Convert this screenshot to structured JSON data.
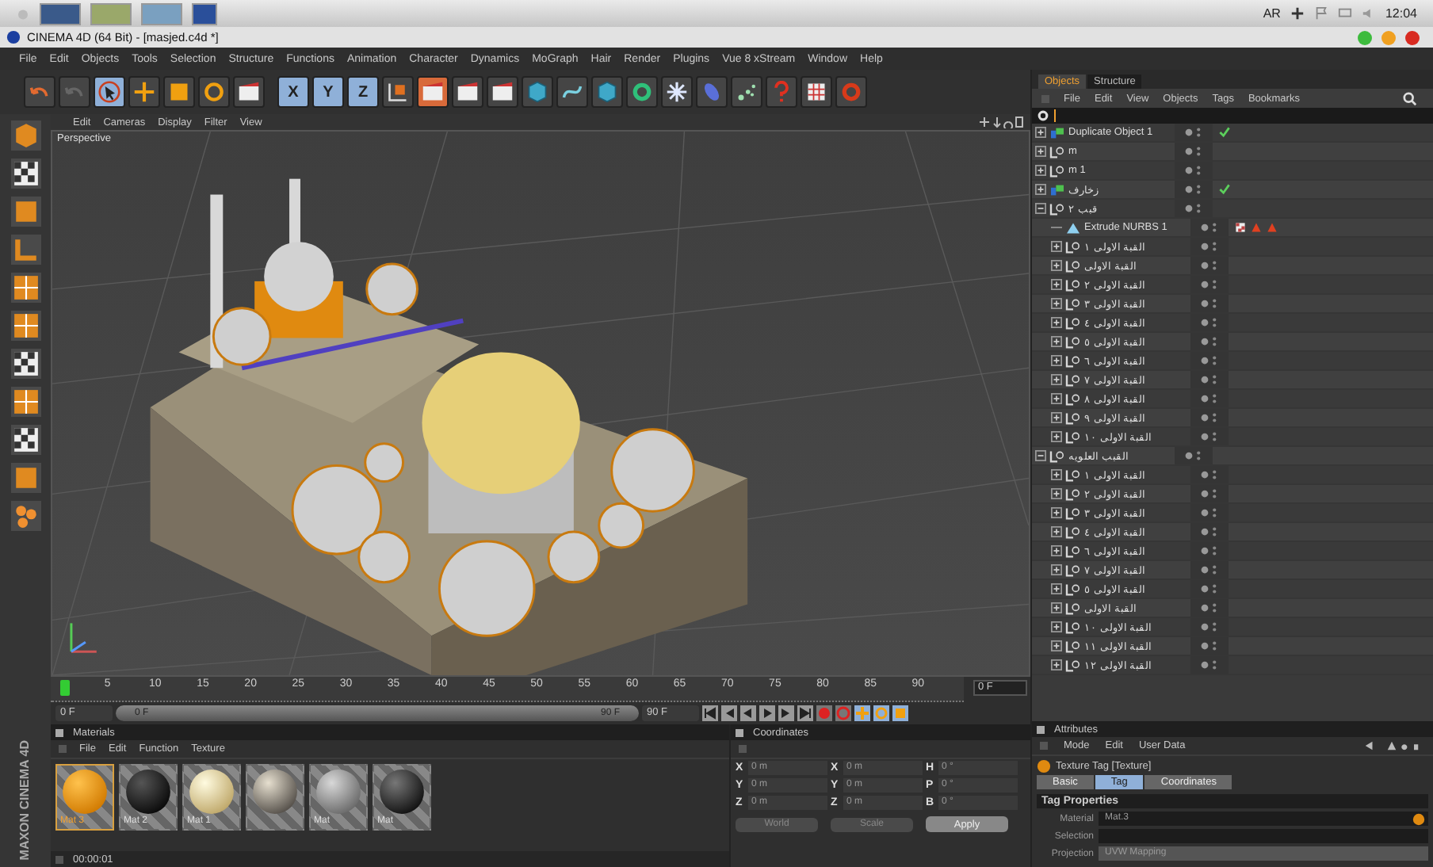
{
  "os_bar": {
    "language": "AR",
    "clock": "12:04"
  },
  "window": {
    "title": "CINEMA 4D (64 Bit) - [masjed.c4d *]"
  },
  "menu": [
    "File",
    "Edit",
    "Objects",
    "Tools",
    "Selection",
    "Structure",
    "Functions",
    "Animation",
    "Character",
    "Dynamics",
    "MoGraph",
    "Hair",
    "Render",
    "Plugins",
    "Vue 8 xStream",
    "Window",
    "Help"
  ],
  "toolbar": {
    "axis_buttons": [
      {
        "label": "X",
        "selected": true
      },
      {
        "label": "Y",
        "selected": true
      },
      {
        "label": "Z",
        "selected": true
      }
    ]
  },
  "viewport": {
    "menu": [
      "Edit",
      "Cameras",
      "Display",
      "Filter",
      "View"
    ],
    "camera": "Perspective"
  },
  "timeline": {
    "ticks": [
      "5",
      "10",
      "15",
      "20",
      "25",
      "30",
      "35",
      "40",
      "45",
      "50",
      "55",
      "60",
      "65",
      "70",
      "75",
      "80",
      "85",
      "90"
    ],
    "playhead": {
      "level": 0
    },
    "current_frame": "0 F",
    "start_field": "0 F",
    "range": {
      "level": 1
    },
    "range_start": "0 F",
    "range_end": "90 F",
    "end_field": "90 F"
  },
  "materials": {
    "title": "Materials",
    "menu": [
      "File",
      "Edit",
      "Function",
      "Texture"
    ],
    "items": [
      {
        "label": "Mat 3",
        "kind": "orange",
        "selected": true
      },
      {
        "label": "Mat 2",
        "kind": "black",
        "selected": false
      },
      {
        "label": "Mat 1",
        "kind": "cream",
        "selected": false
      },
      {
        "kind": "rough",
        "selected": false
      },
      {
        "label": "Mat",
        "kind": "glass",
        "selected": false
      },
      {
        "label": "Mat",
        "kind": "dark",
        "selected": false
      }
    ],
    "status": "00:00:01",
    "logo": "MAXON CINEMA 4D"
  },
  "coordinates": {
    "title": "Coordinates",
    "rows": [
      {
        "position_label": "X",
        "position_value": "0 m",
        "size_label": "X",
        "size_value": "0 m",
        "rotation_label": "H",
        "rotation_value": "0 °"
      },
      {
        "position_label": "Y",
        "position_value": "0 m",
        "size_label": "Y",
        "size_value": "0 m",
        "rotation_label": "P",
        "rotation_value": "0 °"
      },
      {
        "position_label": "Z",
        "position_value": "0 m",
        "size_label": "Z",
        "size_value": "0 m",
        "rotation_label": "B",
        "rotation_value": "0 °"
      }
    ],
    "mode_dropdown": "World",
    "size_dropdown": "Scale",
    "apply": "Apply"
  },
  "objects": {
    "tabs": [
      {
        "label": "Objects",
        "selected": true
      },
      {
        "label": "Structure",
        "selected": false
      }
    ],
    "menu": [
      "File",
      "Edit",
      "View",
      "Objects",
      "Tags",
      "Bookmarks"
    ],
    "tree": [
      {
        "name": "Duplicate Object 1",
        "kind": "duplicate",
        "expanded": false,
        "tags": [
          {
            "kind": "check"
          }
        ]
      },
      {
        "name": "m",
        "kind": "null",
        "expanded": false
      },
      {
        "name": "m 1",
        "kind": "null",
        "expanded": false
      },
      {
        "name": "زخارف",
        "kind": "duplicate",
        "expanded": false,
        "tags": [
          {
            "kind": "check"
          }
        ]
      },
      {
        "name": "قبب ٢",
        "kind": "null",
        "expanded": true,
        "children": [
          {
            "name": "Extrude NURBS 1",
            "kind": "extrude",
            "tags": [
              {
                "kind": "texture"
              },
              {
                "kind": "warning"
              },
              {
                "kind": "warning"
              }
            ]
          },
          {
            "name": "القبة الاولى ١",
            "kind": "null",
            "expanded": false
          },
          {
            "name": "القبة الاولى",
            "kind": "null",
            "expanded": false
          },
          {
            "name": "القبة الاولى ٢",
            "kind": "null",
            "expanded": false
          },
          {
            "name": "القبة الاولى ٣",
            "kind": "null",
            "expanded": false
          },
          {
            "name": "القبة الاولى ٤",
            "kind": "null",
            "expanded": false
          },
          {
            "name": "القبة الاولى ٥",
            "kind": "null",
            "expanded": false
          },
          {
            "name": "القبة الاولى ٦",
            "kind": "null",
            "expanded": false
          },
          {
            "name": "القبة الاولى ٧",
            "kind": "null",
            "expanded": false
          },
          {
            "name": "القبة الاولى ٨",
            "kind": "null",
            "expanded": false
          },
          {
            "name": "القبة الاولى ٩",
            "kind": "null",
            "expanded": false
          },
          {
            "name": "القبة الاولى ١٠",
            "kind": "null",
            "expanded": false
          }
        ]
      },
      {
        "name": "القبب العلويه",
        "kind": "null",
        "expanded": true,
        "children": [
          {
            "name": "القبة الاولى ١",
            "kind": "null",
            "expanded": false
          },
          {
            "name": "القبة الاولى ٢",
            "kind": "null",
            "expanded": false
          },
          {
            "name": "القبة الاولى ٣",
            "kind": "null",
            "expanded": false
          },
          {
            "name": "القبة الاولى ٤",
            "kind": "null",
            "expanded": false
          },
          {
            "name": "القبة الاولى ٦",
            "kind": "null",
            "expanded": false
          },
          {
            "name": "القبة الاولى ٧",
            "kind": "null",
            "expanded": false
          },
          {
            "name": "القبة الاولى ٥",
            "kind": "null",
            "expanded": false
          },
          {
            "name": "القبة الاولى",
            "kind": "null",
            "expanded": false
          },
          {
            "name": "القبة الاولى ١٠",
            "kind": "null",
            "expanded": false
          },
          {
            "name": "القبة الاولى ١١",
            "kind": "null",
            "expanded": false
          },
          {
            "name": "القبة الاولى ١٢",
            "kind": "null",
            "expanded": false
          }
        ]
      }
    ]
  },
  "attributes": {
    "title": "Attributes",
    "menu": [
      "Mode",
      "Edit",
      "User Data"
    ],
    "object_title": "Texture Tag [Texture]",
    "tabs": [
      {
        "label": "Basic",
        "selected": false
      },
      {
        "label": "Tag",
        "selected": true
      },
      {
        "label": "Coordinates",
        "selected": false
      }
    ],
    "section": "Tag Properties",
    "fields": [
      {
        "label": "Material",
        "value": "Mat.3",
        "kind": "link"
      },
      {
        "label": "Selection",
        "kind": "text"
      },
      {
        "label": "Projection",
        "value": "UVW Mapping",
        "kind": "dropdown"
      }
    ]
  }
}
